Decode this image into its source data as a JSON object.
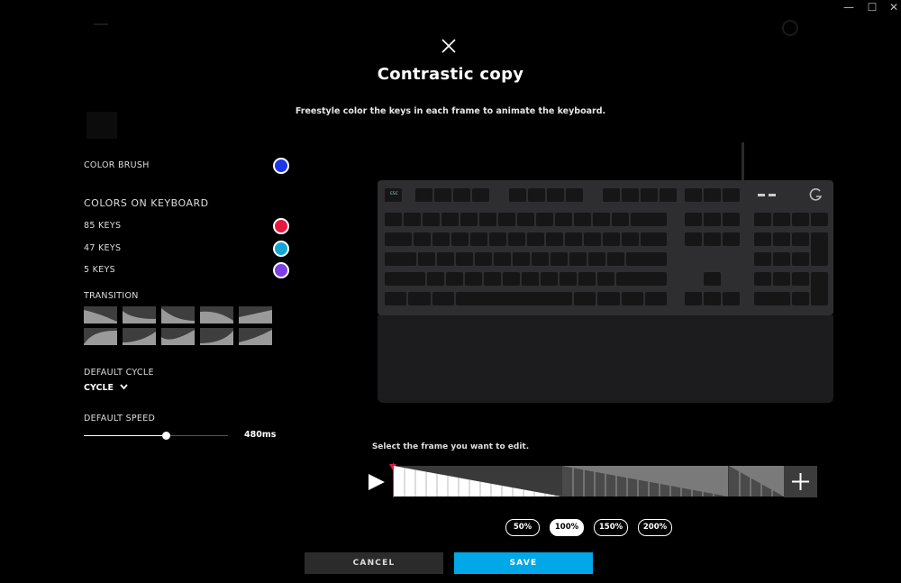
{
  "window": {
    "minimize": "—",
    "maximize": "☐",
    "close": "✕"
  },
  "header": {
    "title": "Contrastic copy",
    "subtitle": "Freestyle color the keys in each frame to animate the keyboard.",
    "close_icon": "close-icon"
  },
  "left": {
    "color_brush_label": "COLOR BRUSH",
    "color_brush_value": "#1c36e8",
    "colors_heading": "COLORS ON KEYBOARD",
    "colors": [
      {
        "label": "85 KEYS",
        "color": "#e8173f"
      },
      {
        "label": "47 KEYS",
        "color": "#13a6d8"
      },
      {
        "label": "5 KEYS",
        "color": "#7b3fe4"
      }
    ],
    "transition_label": "TRANSITION",
    "cycle_label": "DEFAULT CYCLE",
    "cycle_value": "CYCLE",
    "speed_label": "DEFAULT SPEED",
    "speed_value": "480ms",
    "speed_fraction": 0.57
  },
  "timeline": {
    "instruction": "Select the frame you want to edit.",
    "play_icon": "play-icon",
    "add_icon": "plus-icon"
  },
  "zoom": [
    "50%",
    "100%",
    "150%",
    "200%"
  ],
  "zoom_selected": "100%",
  "actions": {
    "cancel": "CANCEL",
    "save": "SAVE"
  },
  "colors": {
    "save_bg": "#00a8e8",
    "cancel_bg": "#2b2b2b",
    "accent_red": "#e8173f"
  }
}
